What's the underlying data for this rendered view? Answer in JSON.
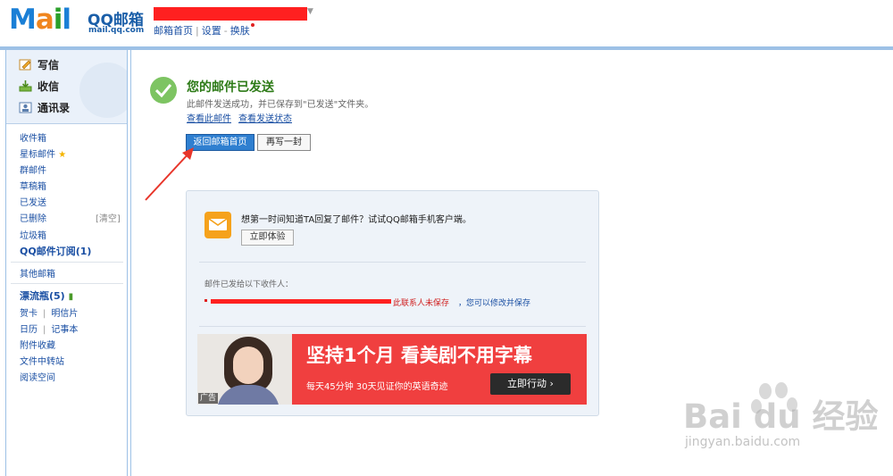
{
  "header": {
    "logo_text_m": "M",
    "logo_text_a": "a",
    "logo_text_i": "i",
    "logo_text_l": "l",
    "logo_qq": "QQ邮箱",
    "logo_domain": "mail.qq.com",
    "links": {
      "home": "邮箱首页",
      "settings": "设置",
      "dash": "-",
      "skin": "换肤"
    }
  },
  "sidebar": {
    "actions": {
      "compose": "写信",
      "inbox": "收信",
      "contacts": "通讯录"
    },
    "folders": {
      "inbox": "收件箱",
      "starred": "星标邮件",
      "group": "群邮件",
      "drafts": "草稿箱",
      "sent": "已发送",
      "deleted": "已删除",
      "clear": "[清空]",
      "spam": "垃圾箱",
      "subscriptions": "QQ邮件订阅(1)",
      "other_mail": "其他邮箱",
      "bottle": "漂流瓶(5)",
      "card": "贺卡",
      "postcard": "明信片",
      "calendar": "日历",
      "notepad": "记事本",
      "attachments": "附件收藏",
      "transfer": "文件中转站",
      "reading": "阅读空间"
    }
  },
  "main": {
    "title": "您的邮件已发送",
    "desc": "此邮件发送成功，并已保存到\"已发送\"文件夹。",
    "link_view": "查看此邮件",
    "link_status": "查看发送状态",
    "btn_back": "返回邮箱首页",
    "btn_again": "再写一封",
    "promo": "想第一时间知道TA回复了邮件？试试QQ邮箱手机客户端。",
    "try_now": "立即体验",
    "recipients_label": "邮件已发给以下收件人：",
    "not_saved": "此联系人未保存",
    "save_hint": "，您可以修改并保存",
    "ad": {
      "tag": "广告",
      "headline": "坚持1个月 看美剧不用字幕",
      "sub": "每天45分钟 30天见证你的英语奇迹",
      "cta": "立即行动 ›"
    }
  },
  "watermark": {
    "text": "Bai du 经验",
    "url": "jingyan.baidu.com"
  },
  "colors": {
    "accent": "#2f7fd0",
    "success": "#7dc462",
    "ad_red": "#f03f3f",
    "redact": "#ff2020"
  }
}
